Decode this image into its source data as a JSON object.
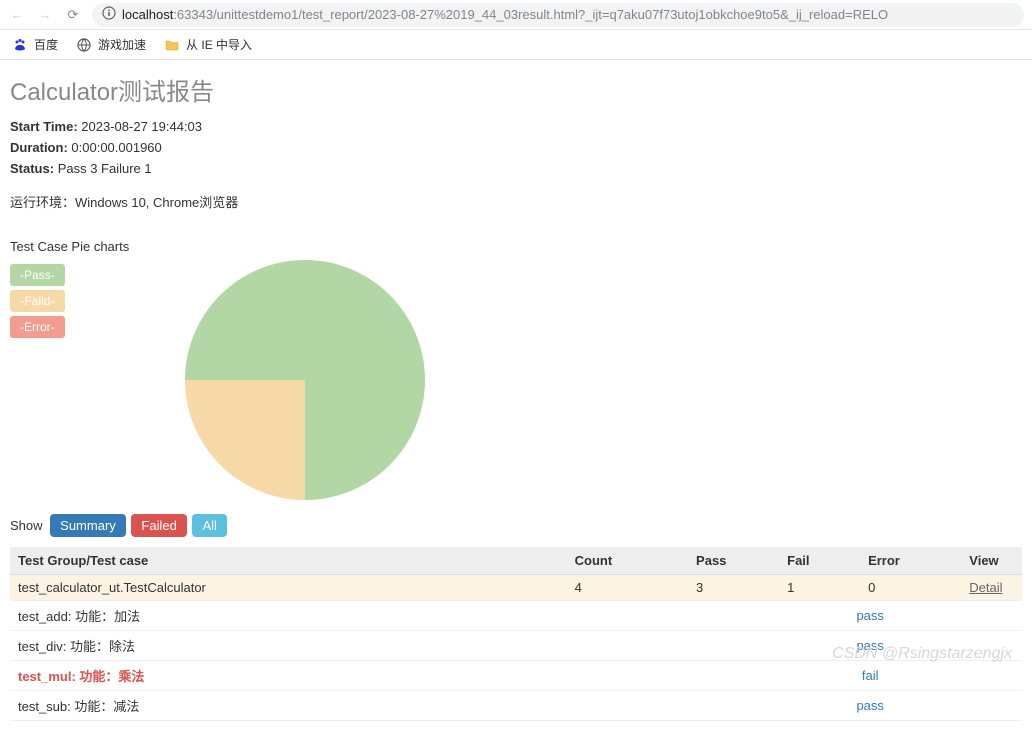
{
  "browser": {
    "url_host": "localhost",
    "url_path": ":63343/unittestdemo1/test_report/2023-08-27%2019_44_03result.html?_ijt=q7aku07f73utoj1obkchoe9to5&_ij_reload=RELO"
  },
  "bookmarks": {
    "baidu": "百度",
    "gamespeed": "游戏加速",
    "ie_import": "从 IE 中导入"
  },
  "report": {
    "title": "Calculator测试报告",
    "start_time_label": "Start Time:",
    "start_time_value": "2023-08-27 19:44:03",
    "duration_label": "Duration:",
    "duration_value": "0:00:00.001960",
    "status_label": "Status:",
    "status_value": "Pass 3 Failure 1",
    "env": "运行环境：Windows 10, Chrome浏览器"
  },
  "chart_data": {
    "type": "pie",
    "title": "Test Case Pie charts",
    "series": [
      {
        "name": "-Pass-",
        "value": 3,
        "color": "#b2d6a4"
      },
      {
        "name": "-Faild-",
        "value": 1,
        "color": "#f7d9a8"
      },
      {
        "name": "-Error-",
        "value": 0,
        "color": "#f29b8f"
      }
    ]
  },
  "filters": {
    "label": "Show",
    "summary": "Summary",
    "failed": "Failed",
    "all": "All"
  },
  "table": {
    "headers": {
      "group": "Test Group/Test case",
      "count": "Count",
      "pass": "Pass",
      "fail": "Fail",
      "error": "Error",
      "view": "View"
    },
    "group": {
      "name": "test_calculator_ut.TestCalculator",
      "count": "4",
      "pass": "3",
      "fail": "1",
      "error": "0",
      "detail": "Detail"
    },
    "cases": [
      {
        "name": "test_add: 功能：加法",
        "status": "pass",
        "failed": false
      },
      {
        "name": "test_div: 功能：除法",
        "status": "pass",
        "failed": false
      },
      {
        "name": "test_mul: 功能：乘法",
        "status": "fail",
        "failed": true
      },
      {
        "name": "test_sub: 功能：减法",
        "status": "pass",
        "failed": false
      }
    ]
  },
  "watermark": "CSDN @Rsingstarzengjx"
}
